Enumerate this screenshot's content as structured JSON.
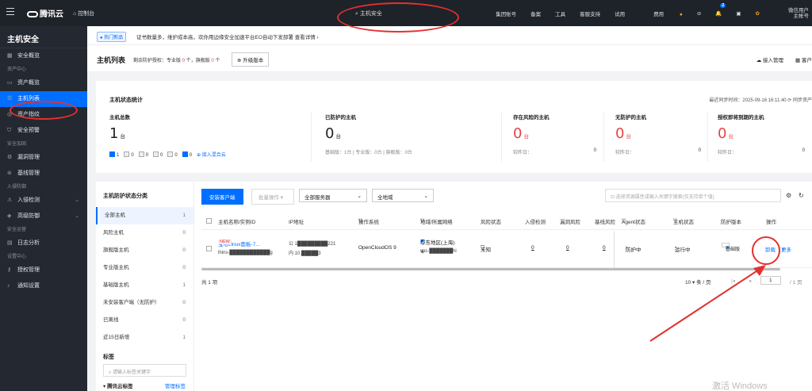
{
  "topbar": {
    "logo": "腾讯云",
    "console": "控制台",
    "search": "主机安全",
    "links": [
      "集团账号",
      "备案",
      "工具",
      "客服支持",
      "试用",
      "费用"
    ],
    "notif_count": "2",
    "user_line1": "微信用户",
    "user_line2": "主帐号"
  },
  "sidebar": {
    "title": "主机安全",
    "items": [
      {
        "type": "item",
        "label": "安全概览",
        "icon": "grid-icon"
      },
      {
        "type": "group",
        "label": "资产中心"
      },
      {
        "type": "item",
        "label": "资产概览",
        "icon": "monitor-icon"
      },
      {
        "type": "item",
        "label": "主机列表",
        "icon": "list-icon",
        "active": true
      },
      {
        "type": "item",
        "label": "资产指纹",
        "icon": "fingerprint-icon"
      },
      {
        "type": "item",
        "label": "安全预警",
        "icon": "shield-icon"
      },
      {
        "type": "group",
        "label": "安全加固"
      },
      {
        "type": "item",
        "label": "漏洞管理",
        "icon": "bug-icon"
      },
      {
        "type": "item",
        "label": "基线管理",
        "icon": "baseline-icon"
      },
      {
        "type": "group",
        "label": "入侵防御"
      },
      {
        "type": "item",
        "label": "入侵检测",
        "icon": "alert-icon",
        "expand": true
      },
      {
        "type": "item",
        "label": "高级防御",
        "icon": "defense-icon",
        "expand": true
      },
      {
        "type": "group",
        "label": "安全运营"
      },
      {
        "type": "item",
        "label": "日志分析",
        "icon": "log-icon"
      },
      {
        "type": "group",
        "label": "设置中心"
      },
      {
        "type": "item",
        "label": "授权管理",
        "icon": "key-icon"
      },
      {
        "type": "item",
        "label": "通知设置",
        "icon": "bell-icon"
      }
    ]
  },
  "notice": {
    "tag": "● 热门新品",
    "text": "证书数量多，维护成本高，欢你用边缘安全加速平台EO自动下发部署  查看详情 ›"
  },
  "header": {
    "title": "主机列表",
    "quota_prefix": "剩余防护授权：专业版",
    "quota_pro": "0",
    "quota_mid": "个，旗舰版",
    "quota_flag": "0",
    "quota_suffix": "个",
    "upgrade": "升级版本",
    "access": "接入管理",
    "customer": "客户"
  },
  "stats": {
    "title": "主机状态统计",
    "sync": "最近同步时间：2025-09-16 16:11:40  ⟳ 同步资产",
    "columns": [
      {
        "label": "主机总数",
        "value": "1",
        "unit": "台",
        "cmp": "",
        "cmp_val": ""
      },
      {
        "label": "已防护的主机",
        "value": "0",
        "unit": "台",
        "cmp": "基础版：1台  |  专业版：0台  |  旗舰版：0台",
        "cmp_val": ""
      },
      {
        "label": "存在风险的主机",
        "value": "0",
        "unit": "台",
        "cmp": "较昨日：",
        "cmp_val": "0"
      },
      {
        "label": "无防护的主机",
        "value": "0",
        "unit": "台",
        "cmp": "较昨日：",
        "cmp_val": "0"
      },
      {
        "label": "授权即将到期的主机",
        "value": "0",
        "unit": "台",
        "cmp": "较昨日：",
        "cmp_val": "0"
      }
    ],
    "host_counts": [
      "1",
      "0",
      "0",
      "0",
      "0",
      "0"
    ],
    "cloud_link": "接入混合云"
  },
  "categories": {
    "title": "主机防护状态分类",
    "items": [
      {
        "label": "全部主机",
        "count": "1"
      },
      {
        "label": "风险主机",
        "count": "0"
      },
      {
        "label": "旗舰版主机",
        "count": "0"
      },
      {
        "label": "专业版主机",
        "count": "0"
      },
      {
        "label": "基础版主机",
        "count": "1"
      },
      {
        "label": "未安装客户端（无防护）",
        "count": "0"
      },
      {
        "label": "已离线",
        "count": "0"
      },
      {
        "label": "近15日新增",
        "count": "1"
      }
    ],
    "tag_title": "标签",
    "tag_placeholder": "请输入标签关键字",
    "tag_cloud": "▾ 腾讯云标签",
    "tag_manage": "管理标签"
  },
  "toolbar": {
    "install": "安装客户端",
    "batch": "批量操作",
    "servers": "全部服务器",
    "region": "全地域",
    "search_placeholder": "选择资源属性或输入关键字搜索(仅支持单个值)"
  },
  "table": {
    "headers": [
      "主机名称/实例ID",
      "IP地址",
      "操作系统",
      "地域/所属网络",
      "风险状态",
      "入侵检测",
      "漏洞风险",
      "基线风险",
      "Agent状态",
      "主机状态",
      "防护版本",
      "操作"
    ],
    "row": {
      "name": "宝塔Linux面板-7...",
      "new": "NEW",
      "id": "lhins-████████████g",
      "ip_public": "公 1█████████221",
      "ip_private": "内 10.█████3",
      "os": "OpenCloudOS 9",
      "region": "华东地区(上海)",
      "vpc": "vpc-███████hi",
      "risk": "未知",
      "intrusion": "0",
      "vuln": "0",
      "baseline": "0",
      "agent": "防护中",
      "host": "运行中",
      "version": "基础版",
      "action": "卸载",
      "more": "更多"
    }
  },
  "footer": {
    "total": "共 1 项",
    "page_size": "10 ▾ 条 / 页",
    "page": "1",
    "pages": "/ 1 页"
  },
  "watermark": "激活 Windows"
}
